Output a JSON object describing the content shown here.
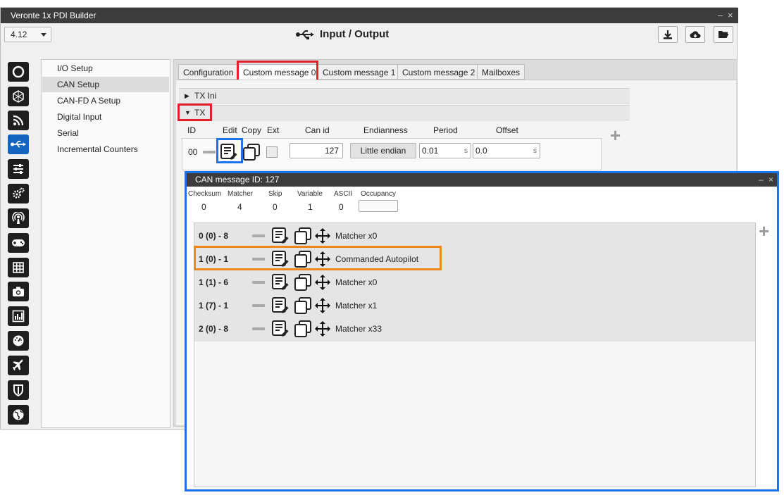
{
  "window": {
    "title": "Veronte 1x PDI Builder",
    "controls": [
      "–",
      "×"
    ]
  },
  "version": "4.12",
  "header": {
    "title": "Input / Output",
    "icon": "usb-icon"
  },
  "header_buttons": [
    {
      "icon": "download-icon"
    },
    {
      "icon": "cloud-download-icon"
    },
    {
      "icon": "folder-open-icon"
    }
  ],
  "sidebar_icons": [
    "power-icon",
    "hexagon-icon",
    "rss-icon",
    "usb-icon",
    "sliders-icon",
    "gears-icon",
    "broadcast-icon",
    "gamepad-icon",
    "grid-icon",
    "camera-icon",
    "chart-icon",
    "gauge-icon",
    "plane-icon",
    "shield-icon",
    "globe-icon"
  ],
  "submenu": {
    "items": [
      "I/O Setup",
      "CAN Setup",
      "CAN-FD A Setup",
      "Digital Input",
      "Serial",
      "Incremental Counters"
    ],
    "selected": "CAN Setup"
  },
  "tabs": [
    "Configuration",
    "Custom message 0",
    "Custom message 1",
    "Custom message 2",
    "Mailboxes"
  ],
  "active_tab": "Custom message 0",
  "sections": {
    "tx_ini": "TX Ini",
    "tx": "TX"
  },
  "tx_columns": [
    "ID",
    "Edit",
    "Copy",
    "Ext",
    "Can id",
    "Endianness",
    "Period",
    "Offset"
  ],
  "tx_row": {
    "id": "00",
    "can_id": "127",
    "endianness": "Little endian",
    "period": "0.01",
    "period_unit": "s",
    "offset": "0.0",
    "offset_unit": "s"
  },
  "popup": {
    "title": "CAN message ID: 127",
    "controls": [
      "–",
      "×"
    ],
    "stats": [
      {
        "label": "Checksum",
        "value": "0"
      },
      {
        "label": "Matcher",
        "value": "4"
      },
      {
        "label": "Skip",
        "value": "0"
      },
      {
        "label": "Variable",
        "value": "1"
      },
      {
        "label": "ASCII",
        "value": "0"
      },
      {
        "label": "Occupancy",
        "value": ""
      }
    ],
    "rows": [
      {
        "id": "0 (0) - 8",
        "label": "Matcher x0"
      },
      {
        "id": "1 (0) - 1",
        "label": "Commanded Autopilot"
      },
      {
        "id": "1 (1) - 6",
        "label": "Matcher x0"
      },
      {
        "id": "1 (7) - 1",
        "label": "Matcher x1"
      },
      {
        "id": "2 (0) - 8",
        "label": "Matcher x33"
      }
    ]
  },
  "highlight_colors": {
    "red": "#e0202a",
    "blue": "#1a73e8",
    "orange": "#f0861e"
  }
}
